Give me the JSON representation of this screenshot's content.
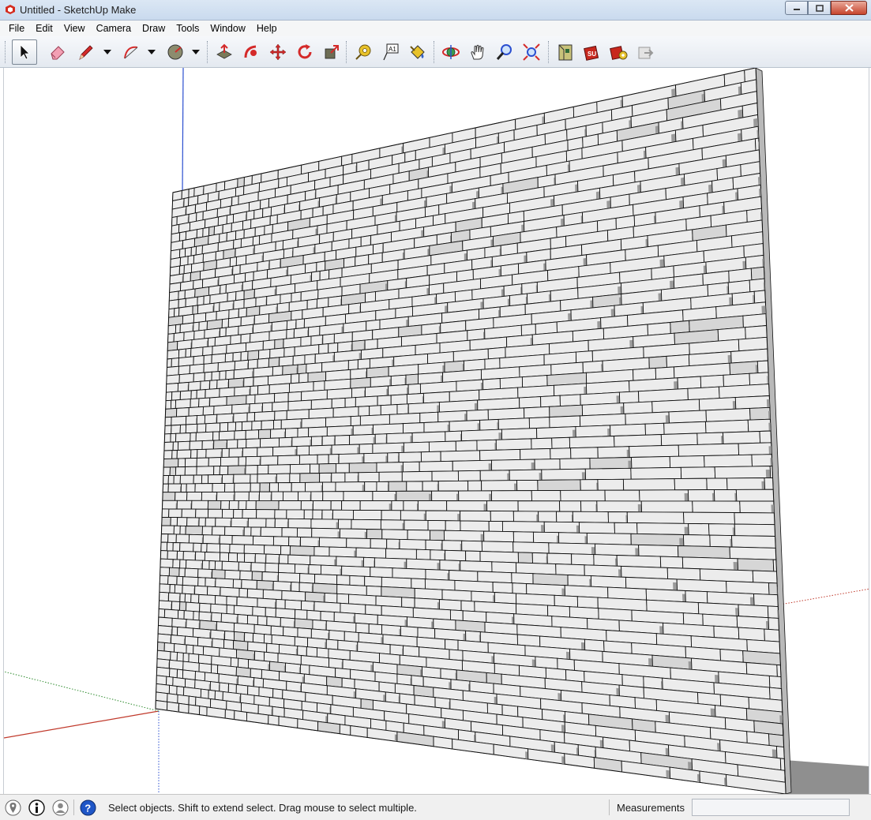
{
  "window": {
    "title": "Untitled - SketchUp Make",
    "app_icon": "sketchup-logo-icon",
    "controls": [
      "minimize-icon",
      "maximize-icon",
      "close-icon"
    ]
  },
  "menu": {
    "items": [
      "File",
      "Edit",
      "View",
      "Camera",
      "Draw",
      "Tools",
      "Window",
      "Help"
    ]
  },
  "toolbar": {
    "tools": [
      {
        "name": "select",
        "icon": "arrow-cursor-icon",
        "active": true
      },
      {
        "name": "eraser",
        "icon": "eraser-icon"
      },
      {
        "name": "line",
        "icon": "pencil-icon",
        "dropdown": true
      },
      {
        "name": "arc",
        "icon": "arc-icon",
        "dropdown": true
      },
      {
        "name": "circle",
        "icon": "circle-icon",
        "dropdown": true
      },
      {
        "name": "push-pull",
        "icon": "push-pull-icon"
      },
      {
        "name": "follow-me",
        "icon": "follow-me-icon"
      },
      {
        "name": "move",
        "icon": "move-icon"
      },
      {
        "name": "rotate",
        "icon": "rotate-icon"
      },
      {
        "name": "scale",
        "icon": "scale-icon"
      },
      {
        "name": "tape-measure",
        "icon": "tape-measure-icon"
      },
      {
        "name": "text",
        "icon": "text-icon"
      },
      {
        "name": "paint-bucket",
        "icon": "paint-bucket-icon"
      },
      {
        "name": "orbit",
        "icon": "orbit-icon"
      },
      {
        "name": "pan",
        "icon": "pan-hand-icon"
      },
      {
        "name": "zoom",
        "icon": "zoom-icon"
      },
      {
        "name": "zoom-extents",
        "icon": "zoom-extents-icon"
      },
      {
        "name": "3d-warehouse",
        "icon": "warehouse-icon"
      },
      {
        "name": "extension-warehouse",
        "icon": "extension-warehouse-icon"
      },
      {
        "name": "extension-manager",
        "icon": "extension-manager-icon"
      },
      {
        "name": "share-model",
        "icon": "share-model-icon"
      }
    ]
  },
  "viewport": {
    "model": "masonry-wall-model",
    "colors": {
      "face": "#ececec",
      "edge": "#111111",
      "shadow": "#9a9a9a",
      "axis_red": "#c0392b",
      "axis_green": "#2e8b2e",
      "axis_blue": "#2b4fd0"
    }
  },
  "status": {
    "icons": [
      "geo-location-icon",
      "credits-icon",
      "user-icon",
      "help-icon"
    ],
    "message": "Select objects. Shift to extend select. Drag mouse to select multiple.",
    "measurements_label": "Measurements",
    "measurements_value": ""
  }
}
